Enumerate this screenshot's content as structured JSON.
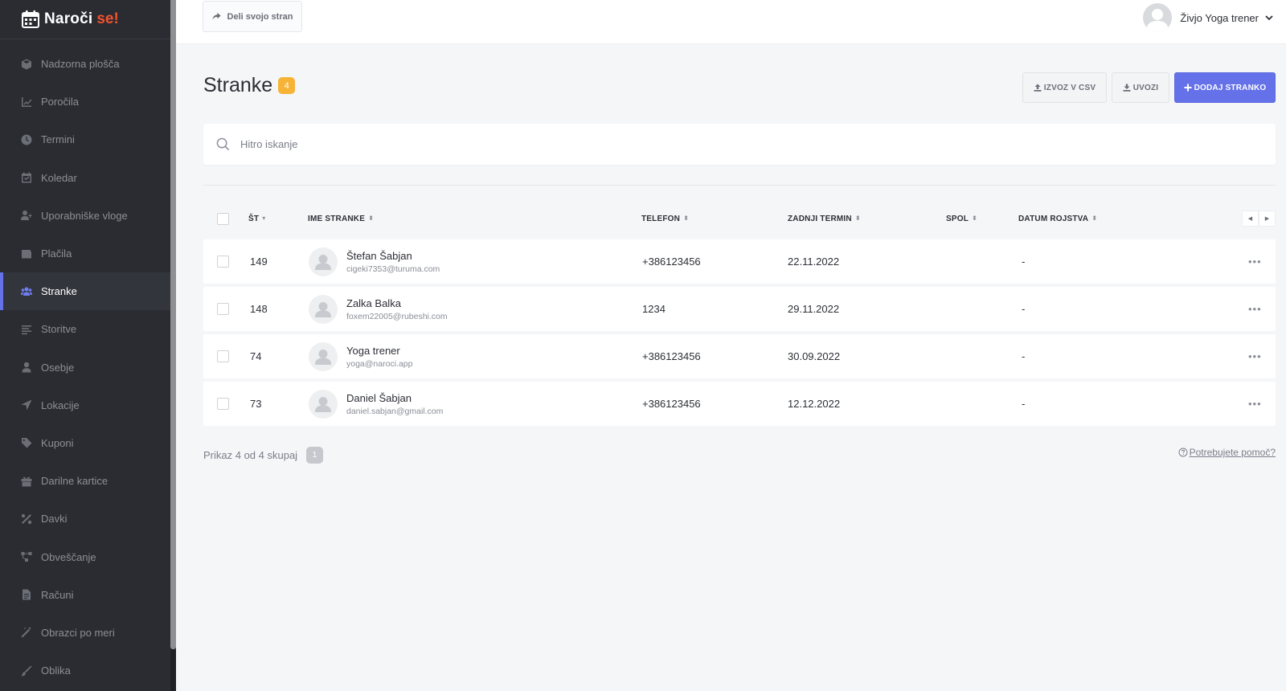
{
  "brand": {
    "name": "Naroči",
    "accent": "se!"
  },
  "sidebar": {
    "items": [
      {
        "key": "dashboard",
        "label": "Nadzorna plošča",
        "icon": "box-icon",
        "active": false
      },
      {
        "key": "reports",
        "label": "Poročila",
        "icon": "chart-icon",
        "active": false
      },
      {
        "key": "appointments",
        "label": "Termini",
        "icon": "clock-icon",
        "active": false
      },
      {
        "key": "calendar",
        "label": "Koledar",
        "icon": "calendar-icon",
        "active": false
      },
      {
        "key": "roles",
        "label": "Uporabniške vloge",
        "icon": "user-plus-icon",
        "active": false
      },
      {
        "key": "payments",
        "label": "Plačila",
        "icon": "wallet-icon",
        "active": false
      },
      {
        "key": "clients",
        "label": "Stranke",
        "icon": "users-icon",
        "active": true
      },
      {
        "key": "services",
        "label": "Storitve",
        "icon": "list-icon",
        "active": false
      },
      {
        "key": "staff",
        "label": "Osebje",
        "icon": "user-icon",
        "active": false
      },
      {
        "key": "locations",
        "label": "Lokacije",
        "icon": "location-arrow-icon",
        "active": false
      },
      {
        "key": "coupons",
        "label": "Kuponi",
        "icon": "tag-icon",
        "active": false
      },
      {
        "key": "giftcards",
        "label": "Darilne kartice",
        "icon": "gift-icon",
        "active": false
      },
      {
        "key": "taxes",
        "label": "Davki",
        "icon": "percent-icon",
        "active": false
      },
      {
        "key": "notifications",
        "label": "Obveščanje",
        "icon": "network-icon",
        "active": false
      },
      {
        "key": "invoices",
        "label": "Računi",
        "icon": "file-icon",
        "active": false
      },
      {
        "key": "forms",
        "label": "Obrazci po meri",
        "icon": "magic-wand-icon",
        "active": false
      },
      {
        "key": "design",
        "label": "Oblika",
        "icon": "brush-icon",
        "active": false
      }
    ]
  },
  "topbar": {
    "share_label": "Deli svojo stran",
    "user_name": "Živjo Yoga trener"
  },
  "header": {
    "title": "Stranke",
    "count": "4",
    "export_label": "IZVOZ V CSV",
    "import_label": "UVOZI",
    "add_label": "DODAJ STRANKO"
  },
  "search": {
    "placeholder": "Hitro iskanje",
    "value": ""
  },
  "table": {
    "columns": {
      "num": "ŠT",
      "name": "IME STRANKE",
      "phone": "TELEFON",
      "last": "ZADNJI TERMIN",
      "gender": "SPOL",
      "birth": "DATUM ROJSTVA"
    },
    "rows": [
      {
        "num": "149",
        "name": "Štefan Šabjan",
        "email": "cigeki7353@turuma.com",
        "phone": "+386123456",
        "last": "22.11.2022",
        "gender": "-",
        "more": "•••"
      },
      {
        "num": "148",
        "name": "Zalka Balka",
        "email": "foxem22005@rubeshi.com",
        "phone": "1234",
        "last": "29.11.2022",
        "gender": "-",
        "more": "•••"
      },
      {
        "num": "74",
        "name": "Yoga trener",
        "email": "yoga@naroci.app",
        "phone": "+386123456",
        "last": "30.09.2022",
        "gender": "-",
        "more": "•••"
      },
      {
        "num": "73",
        "name": "Daniel Šabjan",
        "email": "daniel.sabjan@gmail.com",
        "phone": "+386123456",
        "last": "12.12.2022",
        "gender": "-",
        "more": "•••"
      }
    ]
  },
  "footer": {
    "summary": "Prikaz 4 od 4 skupaj",
    "page": "1",
    "help": "Potrebujete pomoč?"
  },
  "colors": {
    "sidebar_bg": "#2a2c32",
    "accent": "#6471e8",
    "brand_accent": "#f4522d",
    "badge": "#f7b335"
  }
}
